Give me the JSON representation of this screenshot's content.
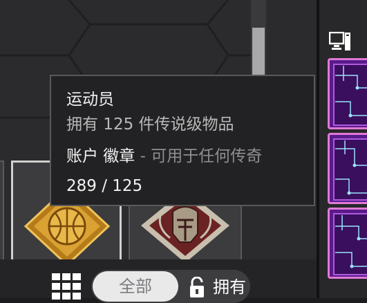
{
  "tooltip": {
    "title": "运动员",
    "description": "拥有 125 件传说级物品",
    "badge_type": "账户 徽章",
    "badge_note": " - 可用于任何传奇",
    "progress": "289 / 125"
  },
  "filter": {
    "all_label": "全部",
    "owned_label": "拥有"
  },
  "icons": {
    "grid": "grid-view-icon",
    "lock": "unlock-icon",
    "pc": "pc-icon",
    "basketball_badge": "basketball-badge-icon",
    "helmet_badge": "helmet-badge-icon"
  },
  "colors": {
    "accent_gold": "#d9a233",
    "card_purple": "#5a1a8a",
    "card_border": "#e07ad8"
  }
}
